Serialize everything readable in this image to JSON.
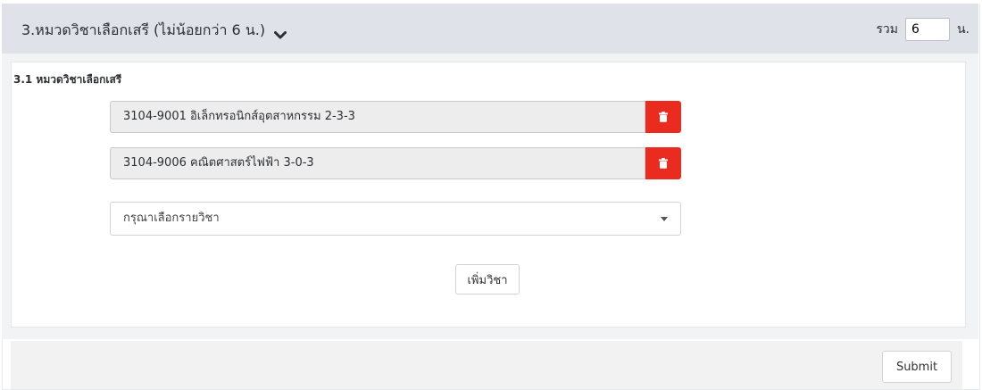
{
  "header": {
    "title": "3.หมวดวิชาเลือกเสรี (ไม่น้อยกว่า 6 น.)",
    "total_label": "รวม",
    "total_value": "6",
    "unit": "น."
  },
  "section": {
    "title": "3.1 หมวดวิชาเลือกเสรี",
    "selected_courses": [
      "3104-9001 อิเล็กทรอนิกส์อุตสาหกรรม 2-3-3",
      "3104-9006 คณิตศาสตร์ไฟฟ้า 3-0-3"
    ],
    "select_placeholder": "กรุณาเลือกรายวิชา",
    "add_button": "เพิ่มวิชา"
  },
  "footer": {
    "submit_button": "Submit"
  },
  "icons": {
    "chevron": "chevron-down-icon",
    "delete": "trash-icon"
  },
  "colors": {
    "header_bg": "#dfe3e9",
    "delete_red": "#ea2b1f"
  }
}
